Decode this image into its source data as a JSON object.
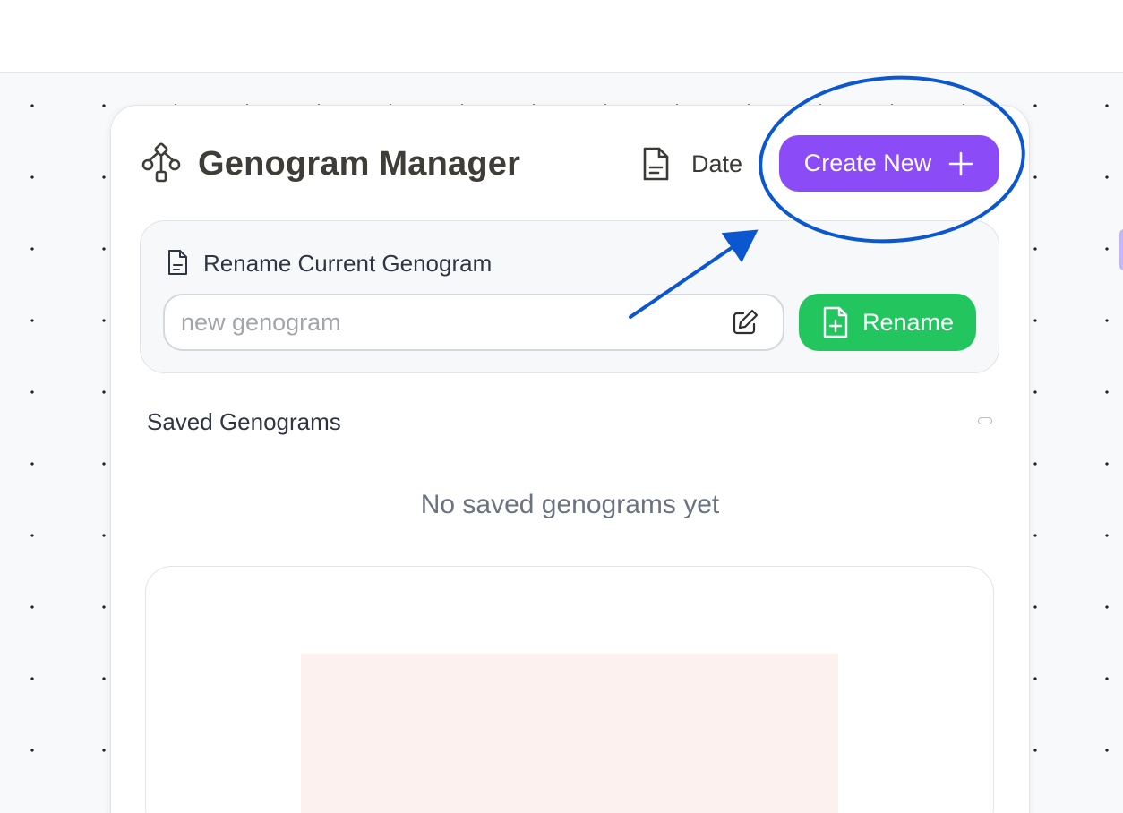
{
  "header": {
    "title": "Genogram Manager",
    "title_icon": "genogram-tree-icon",
    "date_label": "Date",
    "date_icon": "document-icon",
    "create_button_label": "Create New",
    "create_button_icon": "plus-icon"
  },
  "rename_section": {
    "heading": "Rename Current Genogram",
    "heading_icon": "document-icon",
    "input_placeholder": "new genogram",
    "input_value": "",
    "edit_icon": "pencil-edit-icon",
    "button_label": "Rename",
    "button_icon": "file-plus-icon"
  },
  "saved_section": {
    "heading": "Saved Genograms",
    "collapse_icon": "minus-icon",
    "empty_message": "No saved genograms yet"
  },
  "annotation": {
    "type": "circle-with-arrow",
    "target": "create-new-button",
    "color": "#0b57d0"
  },
  "colors": {
    "accent_purple": "#8b4cf7",
    "success_green": "#22c55e",
    "canvas_bg": "#f8f9fb",
    "preview_bg": "#fdf1ef"
  }
}
